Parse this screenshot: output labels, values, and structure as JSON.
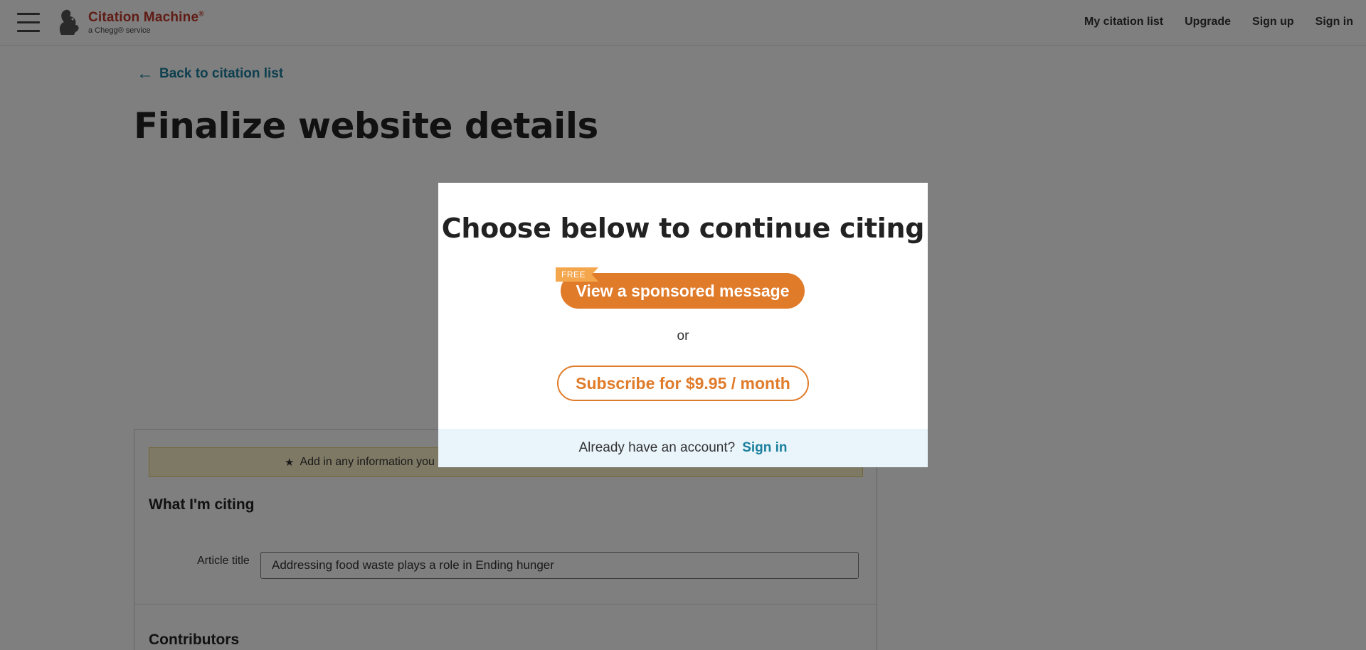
{
  "header": {
    "logo_name": "Citation Machine",
    "logo_sub": "a Chegg® service",
    "nav": [
      "My citation list",
      "Upgrade",
      "Sign up",
      "Sign in"
    ]
  },
  "page": {
    "back_link": "Back to citation list",
    "title": "Finalize website details",
    "banner_text": "Add in any information you",
    "section_what": "What I'm citing",
    "article_title_label": "Article title",
    "article_title_value": "Addressing food waste plays a role in Ending hunger",
    "section_contributors": "Contributors"
  },
  "modal": {
    "title": "Choose below to continue citing",
    "free_badge": "FREE",
    "sponsor_button": "View a sponsored message",
    "or": "or",
    "subscribe_button": "Subscribe for $9.95 / month",
    "footer_text": "Already have an account?",
    "footer_link": "Sign in"
  },
  "colors": {
    "accent_orange": "#e07b2a",
    "link_teal": "#1a7f9c",
    "brand_red": "#c0392b"
  }
}
